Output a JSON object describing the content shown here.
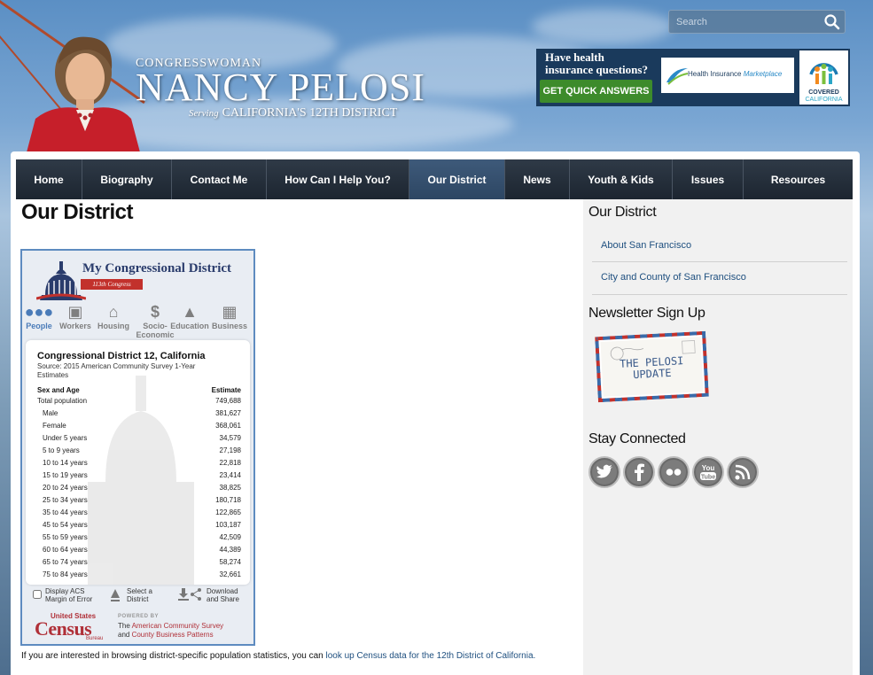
{
  "search": {
    "placeholder": "Search"
  },
  "brand": {
    "top": "CONGRESSWOMAN",
    "name": "NANCY PELOSI",
    "serving": "Serving",
    "district": "CALIFORNIA'S 12TH DISTRICT"
  },
  "promo": {
    "question_line1": "Have health",
    "question_line2": "insurance questions?",
    "button": "GET QUICK ANSWERS",
    "marketplace_a": "Health Insurance ",
    "marketplace_b": "Marketplace",
    "covered_a": "COVERED",
    "covered_b": "CALIFORNIA"
  },
  "nav": {
    "items": [
      {
        "label": "Home"
      },
      {
        "label": "Biography"
      },
      {
        "label": "Contact Me"
      },
      {
        "label": "How Can I Help You?"
      },
      {
        "label": "Our District"
      },
      {
        "label": "News"
      },
      {
        "label": "Youth & Kids"
      },
      {
        "label": "Issues"
      },
      {
        "label": "Resources"
      }
    ],
    "active": "Our District"
  },
  "main": {
    "title": "Our District",
    "note_prefix": "If you are interested in browsing district-specific population statistics, you can ",
    "note_link": "look up Census data for the 12th District of California."
  },
  "census": {
    "title": "My Congressional District",
    "ribbon": "113th Congress",
    "tabs": [
      {
        "label": "People",
        "icon": "people-icon",
        "glyph": "👥"
      },
      {
        "label": "Workers",
        "icon": "briefcase-icon",
        "glyph": "💼"
      },
      {
        "label": "Housing",
        "icon": "house-icon",
        "glyph": "⌂"
      },
      {
        "label": "Socio-Economic",
        "icon": "dollar-icon",
        "glyph": "$"
      },
      {
        "label": "Education",
        "icon": "graduation-cap-icon",
        "glyph": "🎓"
      },
      {
        "label": "Business",
        "icon": "building-icon",
        "glyph": "▦"
      }
    ],
    "card_title": "Congressional District 12, California",
    "source": "Source: 2015 American Community Survey 1-Year Estimates",
    "col_left": "Sex and Age",
    "col_right": "Estimate",
    "rows": [
      {
        "label": "Total population",
        "value": "749,688"
      },
      {
        "label": "Male",
        "value": "381,627"
      },
      {
        "label": "Female",
        "value": "368,061"
      },
      {
        "label": "Under 5 years",
        "value": "34,579"
      },
      {
        "label": "5 to 9 years",
        "value": "27,198"
      },
      {
        "label": "10 to 14 years",
        "value": "22,818"
      },
      {
        "label": "15 to 19 years",
        "value": "23,414"
      },
      {
        "label": "20 to 24 years",
        "value": "38,825"
      },
      {
        "label": "25 to 34 years",
        "value": "180,718"
      },
      {
        "label": "35 to 44 years",
        "value": "122,865"
      },
      {
        "label": "45 to 54 years",
        "value": "103,187"
      },
      {
        "label": "55 to 59 years",
        "value": "42,509"
      },
      {
        "label": "60 to 64 years",
        "value": "44,389"
      },
      {
        "label": "65 to 74 years",
        "value": "58,274"
      },
      {
        "label": "75 to 84 years",
        "value": "32,661"
      }
    ],
    "foot": {
      "acs_a": "Display ACS",
      "acs_b": "Margin of Error",
      "select_a": "Select a",
      "select_b": "District",
      "download_a": "Download",
      "download_b": "and Share"
    },
    "brand": {
      "us": "United States",
      "census": "Census",
      "bureau": "Bureau",
      "powered": "POWERED BY",
      "the": "The ",
      "acs": "American Community Survey",
      "and": "and ",
      "cbp": "County Business Patterns"
    }
  },
  "sidebar": {
    "district_heading": "Our District",
    "links": [
      {
        "label": "About San Francisco"
      },
      {
        "label": "City and County of San Francisco"
      }
    ],
    "newsletter_heading": "Newsletter Sign Up",
    "newsletter_a": "THE PELOSI",
    "newsletter_b": "UPDATE",
    "connected_heading": "Stay Connected",
    "social": [
      {
        "name": "twitter-icon",
        "glyph": "t"
      },
      {
        "name": "facebook-icon",
        "glyph": "f"
      },
      {
        "name": "flickr-icon",
        "glyph": "••"
      },
      {
        "name": "youtube-icon",
        "glyph": "You Tube"
      },
      {
        "name": "rss-icon",
        "glyph": ")))"
      }
    ]
  },
  "colors": {
    "nav_bg": "#1c2530",
    "nav_active": "#2d4663",
    "link": "#1e4f7f",
    "census_red": "#b03038",
    "census_blue": "#4a7bb8"
  }
}
